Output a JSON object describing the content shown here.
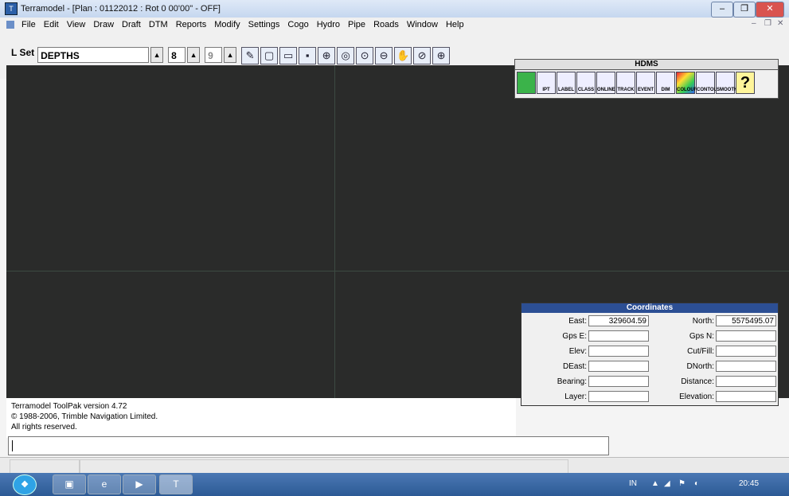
{
  "window": {
    "title": "Terramodel - [Plan : 01122012 : Rot 0 00'00\" - OFF]"
  },
  "menu": {
    "items": [
      "File",
      "Edit",
      "View",
      "Draw",
      "Draft",
      "DTM",
      "Reports",
      "Modify",
      "Settings",
      "Cogo",
      "Hydro",
      "Pipe",
      "Roads",
      "Window",
      "Help"
    ]
  },
  "toolbar": {
    "lset_label": "L Set",
    "layer_value": "DEPTHS",
    "spin1_value": "8",
    "spin2_value": "9"
  },
  "hdms": {
    "title": "HDMS",
    "buttons": [
      "",
      "IPT",
      "LABEL",
      "CLASS",
      "ONLINE",
      "TRACK",
      "EVENT",
      "DIM",
      "COLOUR",
      "CONTOUR",
      "SMOOTH",
      "?"
    ]
  },
  "coordinates": {
    "title": "Coordinates",
    "rows": [
      {
        "left_label": "East:",
        "left_value": "329604.59",
        "right_label": "North:",
        "right_value": "5575495.07"
      },
      {
        "left_label": "Gps E:",
        "left_value": "",
        "right_label": "Gps N:",
        "right_value": ""
      },
      {
        "left_label": "Elev:",
        "left_value": "",
        "right_label": "Cut/Fill:",
        "right_value": ""
      },
      {
        "left_label": "DEast:",
        "left_value": "",
        "right_label": "DNorth:",
        "right_value": ""
      },
      {
        "left_label": "Bearing:",
        "left_value": "",
        "right_label": "Distance:",
        "right_value": ""
      },
      {
        "left_label": "Layer:",
        "left_value": "",
        "right_label": "Elevation:",
        "right_value": ""
      }
    ]
  },
  "console": {
    "line1": "Terramodel ToolPak version 4.72",
    "line2": "© 1988-2006, Trimble Navigation Limited.",
    "line3": "All rights reserved."
  },
  "taskbar": {
    "lang": "IN",
    "clock": "20:45"
  }
}
